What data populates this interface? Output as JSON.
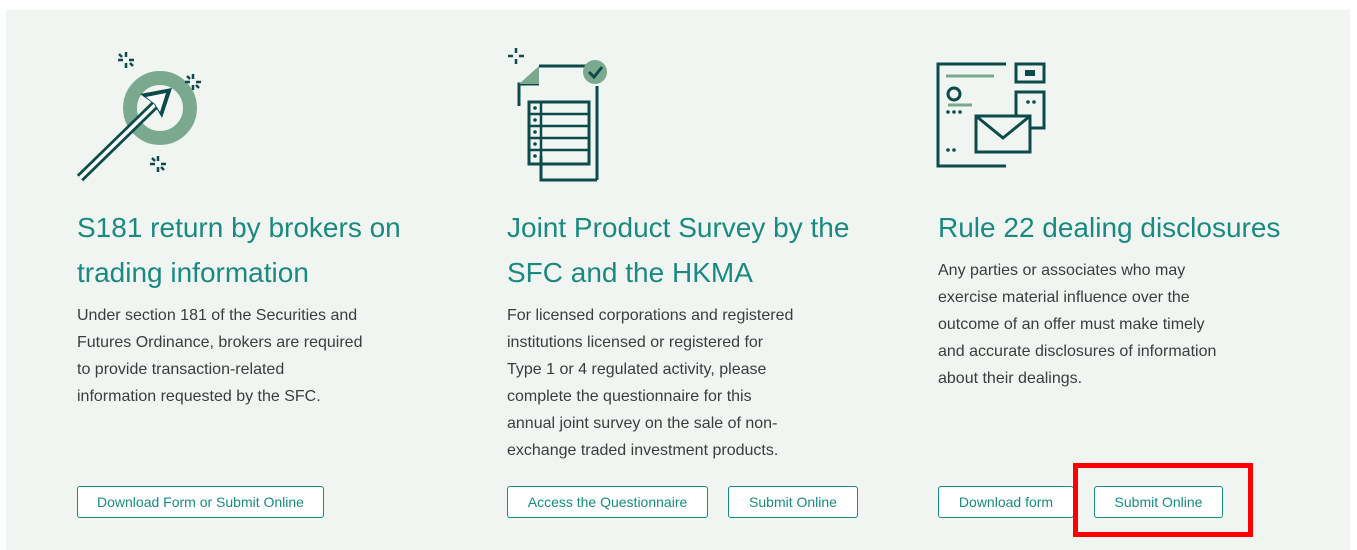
{
  "colors": {
    "accent": "#1a8a80",
    "icon_dark": "#0d4a4a",
    "icon_light": "#7aa98f",
    "panel_bg": "#f1f5f2",
    "highlight": "#ff0000"
  },
  "cards": [
    {
      "icon": "target-arrow-icon",
      "title_line1": "S181 return by brokers on",
      "title_line2": "trading information",
      "desc": [
        "Under section 181 of the Securities and",
        "Futures Ordinance, brokers are required",
        "to provide transaction-related",
        "information requested by the SFC."
      ],
      "buttons": [
        "Download Form or Submit Online"
      ]
    },
    {
      "icon": "survey-document-icon",
      "title_line1": "Joint Product Survey by the",
      "title_line2": "SFC and the HKMA",
      "desc": [
        "For licensed corporations and registered",
        "institutions licensed or registered for",
        "Type 1 or 4 regulated activity, please",
        "complete the questionnaire for this",
        "annual joint survey on the sale of non-",
        "exchange traded investment products."
      ],
      "buttons": [
        "Access the Questionnaire",
        "Submit Online"
      ]
    },
    {
      "icon": "documents-envelope-icon",
      "title_line1": "Rule 22 dealing disclosures",
      "desc": [
        "Any parties or associates who may",
        "exercise material influence over the",
        "outcome of an offer must make timely",
        "and accurate disclosures of information",
        "about their dealings."
      ],
      "buttons": [
        "Download form",
        "Submit Online"
      ]
    }
  ]
}
